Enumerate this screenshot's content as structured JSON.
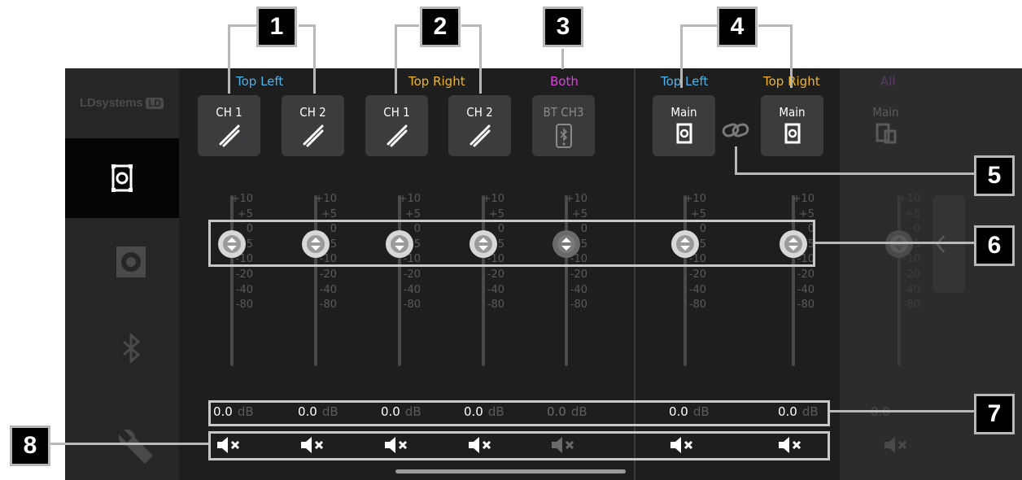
{
  "app": {
    "logo_text": "LDsystems",
    "logo_badge": "LD"
  },
  "sidebar": {
    "items": [
      {
        "name": "speaker-setup",
        "active": true
      },
      {
        "name": "speaker",
        "active": false
      },
      {
        "name": "bluetooth",
        "active": false
      },
      {
        "name": "settings",
        "active": false
      }
    ]
  },
  "colors": {
    "blue": "#4fb3e8",
    "yellow": "#f0b429",
    "magenta": "#e040e0"
  },
  "groups": {
    "top_left": "Top Left",
    "top_right": "Top Right",
    "both": "Both",
    "main_top_left": "Top Left",
    "main_top_right": "Top Right",
    "all": "All"
  },
  "channels": [
    {
      "label": "CH 1",
      "icon": "cable-icon",
      "db": "0.0",
      "unit": "dB"
    },
    {
      "label": "CH 2",
      "icon": "cable-icon",
      "db": "0.0",
      "unit": "dB"
    },
    {
      "label": "CH 1",
      "icon": "cable-icon",
      "db": "0.0",
      "unit": "dB"
    },
    {
      "label": "CH 2",
      "icon": "cable-icon",
      "db": "0.0",
      "unit": "dB"
    },
    {
      "label": "BT CH3",
      "icon": "bluetooth-phone-icon",
      "db": "0.0",
      "unit": "dB"
    },
    {
      "label": "Main",
      "icon": "speaker-icon",
      "db": "0.0",
      "unit": "dB"
    },
    {
      "label": "Main",
      "icon": "speaker-icon",
      "db": "0.0",
      "unit": "dB"
    },
    {
      "label": "Main",
      "icon": "speakers-icon",
      "db": "0.0",
      "unit": "dB"
    }
  ],
  "scale": [
    "+10",
    "+5",
    "0",
    "-5",
    "-10",
    "-20",
    "-40",
    "-80"
  ],
  "fader_level_db": 0,
  "callouts": [
    "1",
    "2",
    "3",
    "4",
    "5",
    "6",
    "7",
    "8"
  ]
}
